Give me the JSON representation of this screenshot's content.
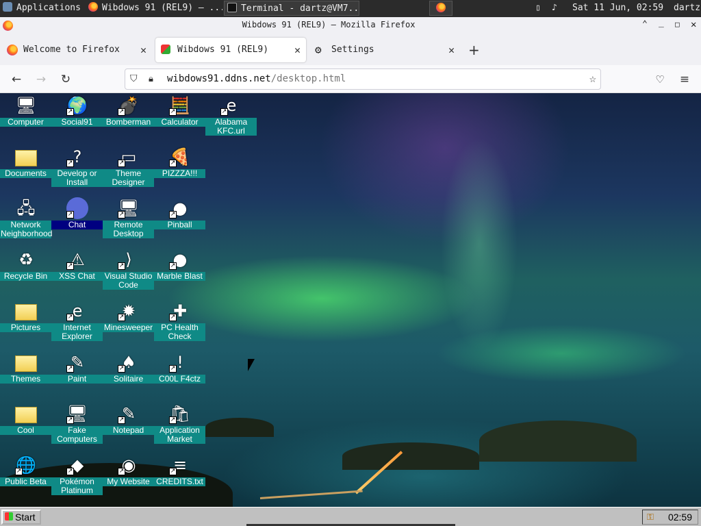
{
  "panel": {
    "applications": "Applications",
    "tasks": [
      {
        "label": "Wibdows 91 (REL9) — ...",
        "icon": "firefox-icon"
      },
      {
        "label": "Terminal - dartz@VM7...",
        "icon": "terminal-icon"
      }
    ],
    "datetime": "Sat 11 Jun, 02:59",
    "user": "dartz"
  },
  "window": {
    "title": "Wibdows 91 (REL9) — Mozilla Firefox"
  },
  "tabs": [
    {
      "label": "Welcome to Firefox",
      "icon": "firefox-icon"
    },
    {
      "label": "Wibdows 91 (REL9)",
      "icon": "wibdows-icon"
    },
    {
      "label": "Settings",
      "icon": "gear-icon"
    }
  ],
  "url": {
    "host": "wibdows91.ddns.net",
    "path": "/desktop.html"
  },
  "desktop": {
    "icons": [
      {
        "label": "Computer",
        "icon": "computer-icon",
        "selected": false
      },
      {
        "label": "Social91",
        "icon": "globe-icon",
        "selected": false
      },
      {
        "label": "Bomberman",
        "icon": "bomberman-icon",
        "selected": false
      },
      {
        "label": "Calculator",
        "icon": "calculator-icon",
        "selected": false
      },
      {
        "label": "Alabama KFC.url",
        "icon": "ie-link-icon",
        "selected": false
      },
      {
        "label": "Documents",
        "icon": "folder-icon",
        "selected": false
      },
      {
        "label": "Develop or Install",
        "icon": "develop-icon",
        "selected": false
      },
      {
        "label": "Theme Designer",
        "icon": "window-icon",
        "selected": false
      },
      {
        "label": "PIZZZA!!!",
        "icon": "pizza-icon",
        "selected": false
      },
      {
        "label": "Network Neighborhood",
        "icon": "network-icon",
        "selected": false
      },
      {
        "label": "Chat",
        "icon": "chat-icon",
        "selected": true
      },
      {
        "label": "Remote Desktop",
        "icon": "remote-desktop-icon",
        "selected": false
      },
      {
        "label": "Pinball",
        "icon": "pinball-icon",
        "selected": false
      },
      {
        "label": "Recycle Bin",
        "icon": "recycle-bin-icon",
        "selected": false
      },
      {
        "label": "XSS Chat",
        "icon": "xss-chat-icon",
        "selected": false
      },
      {
        "label": "Visual Studio Code",
        "icon": "vscode-icon",
        "selected": false
      },
      {
        "label": "Marble Blast",
        "icon": "marble-icon",
        "selected": false
      },
      {
        "label": "Pictures",
        "icon": "folder-icon",
        "selected": false
      },
      {
        "label": "Internet Explorer",
        "icon": "ie-icon",
        "selected": false
      },
      {
        "label": "Minesweeper",
        "icon": "mine-icon",
        "selected": false
      },
      {
        "label": "PC Health Check",
        "icon": "pc-health-icon",
        "selected": false
      },
      {
        "label": "Themes",
        "icon": "folder-icon",
        "selected": false
      },
      {
        "label": "Paint",
        "icon": "paint-icon",
        "selected": false
      },
      {
        "label": "Solitaire",
        "icon": "solitaire-icon",
        "selected": false
      },
      {
        "label": "C00L F4ctz",
        "icon": "bulb-icon",
        "selected": false
      },
      {
        "label": "Cool",
        "icon": "folder-icon",
        "selected": false
      },
      {
        "label": "Fake Computers",
        "icon": "computer-icon",
        "selected": false
      },
      {
        "label": "Notepad",
        "icon": "notepad-icon",
        "selected": false
      },
      {
        "label": "Application Market",
        "icon": "market-icon",
        "selected": false
      },
      {
        "label": "Public Beta",
        "icon": "public-beta-icon",
        "selected": false
      },
      {
        "label": "Pokémon Platinum",
        "icon": "pokemon-icon",
        "selected": false
      },
      {
        "label": "My Website",
        "icon": "github-icon",
        "selected": false
      },
      {
        "label": "CREDITS.txt",
        "icon": "text-file-icon",
        "selected": false
      }
    ]
  },
  "taskbar": {
    "start": "Start",
    "clock": "02:59"
  }
}
